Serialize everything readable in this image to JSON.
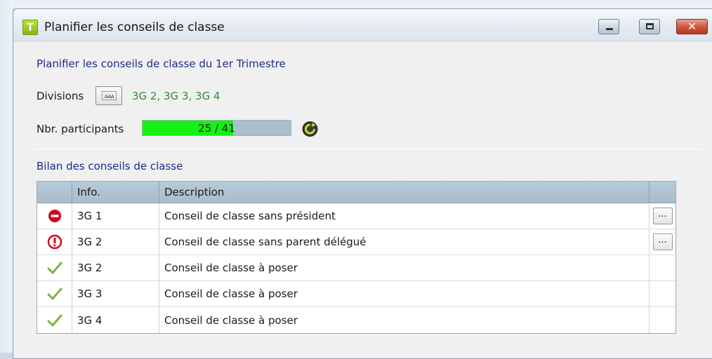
{
  "window": {
    "title": "Planifier les conseils de classe",
    "app_icon_letter": "T",
    "controls": [
      "minimize-icon",
      "maximize-icon",
      "close-icon"
    ]
  },
  "heading": "Planifier les conseils de classe du  1er Trimestre",
  "divisions": {
    "label": "Divisions",
    "button_icon": "list-select-icon",
    "button_glyph": "AAA",
    "value": "3G 2, 3G 3, 3G 4"
  },
  "participants": {
    "label": "Nbr. participants",
    "text": "25 / 41",
    "current": 25,
    "total": 41,
    "refresh_icon": "refresh-icon"
  },
  "bilan": {
    "title": "Bilan des conseils de classe",
    "columns": [
      "",
      "Info.",
      "Description",
      ""
    ],
    "rows": [
      {
        "status": "error",
        "icon": "no-entry-icon",
        "info": "3G 1",
        "description": "Conseil de classe sans président",
        "action": "..."
      },
      {
        "status": "warning",
        "icon": "exclamation-circle-icon",
        "info": "3G 2",
        "description": "Conseil de classe sans parent délégué",
        "action": "..."
      },
      {
        "status": "ok",
        "icon": "checkmark-icon",
        "info": "3G 2",
        "description": "Conseil de classe à poser",
        "action": ""
      },
      {
        "status": "ok",
        "icon": "checkmark-icon",
        "info": "3G 3",
        "description": "Conseil de classe à poser",
        "action": ""
      },
      {
        "status": "ok",
        "icon": "checkmark-icon",
        "info": "3G 4",
        "description": "Conseil de classe à poser",
        "action": ""
      }
    ]
  },
  "colors": {
    "heading": "#1c2a8c",
    "divisions_value": "#2f8a32",
    "progress_fill": "#14f014",
    "progress_track": "#a9bfcc",
    "error": "#d4001a",
    "ok": "#7bb33a"
  }
}
